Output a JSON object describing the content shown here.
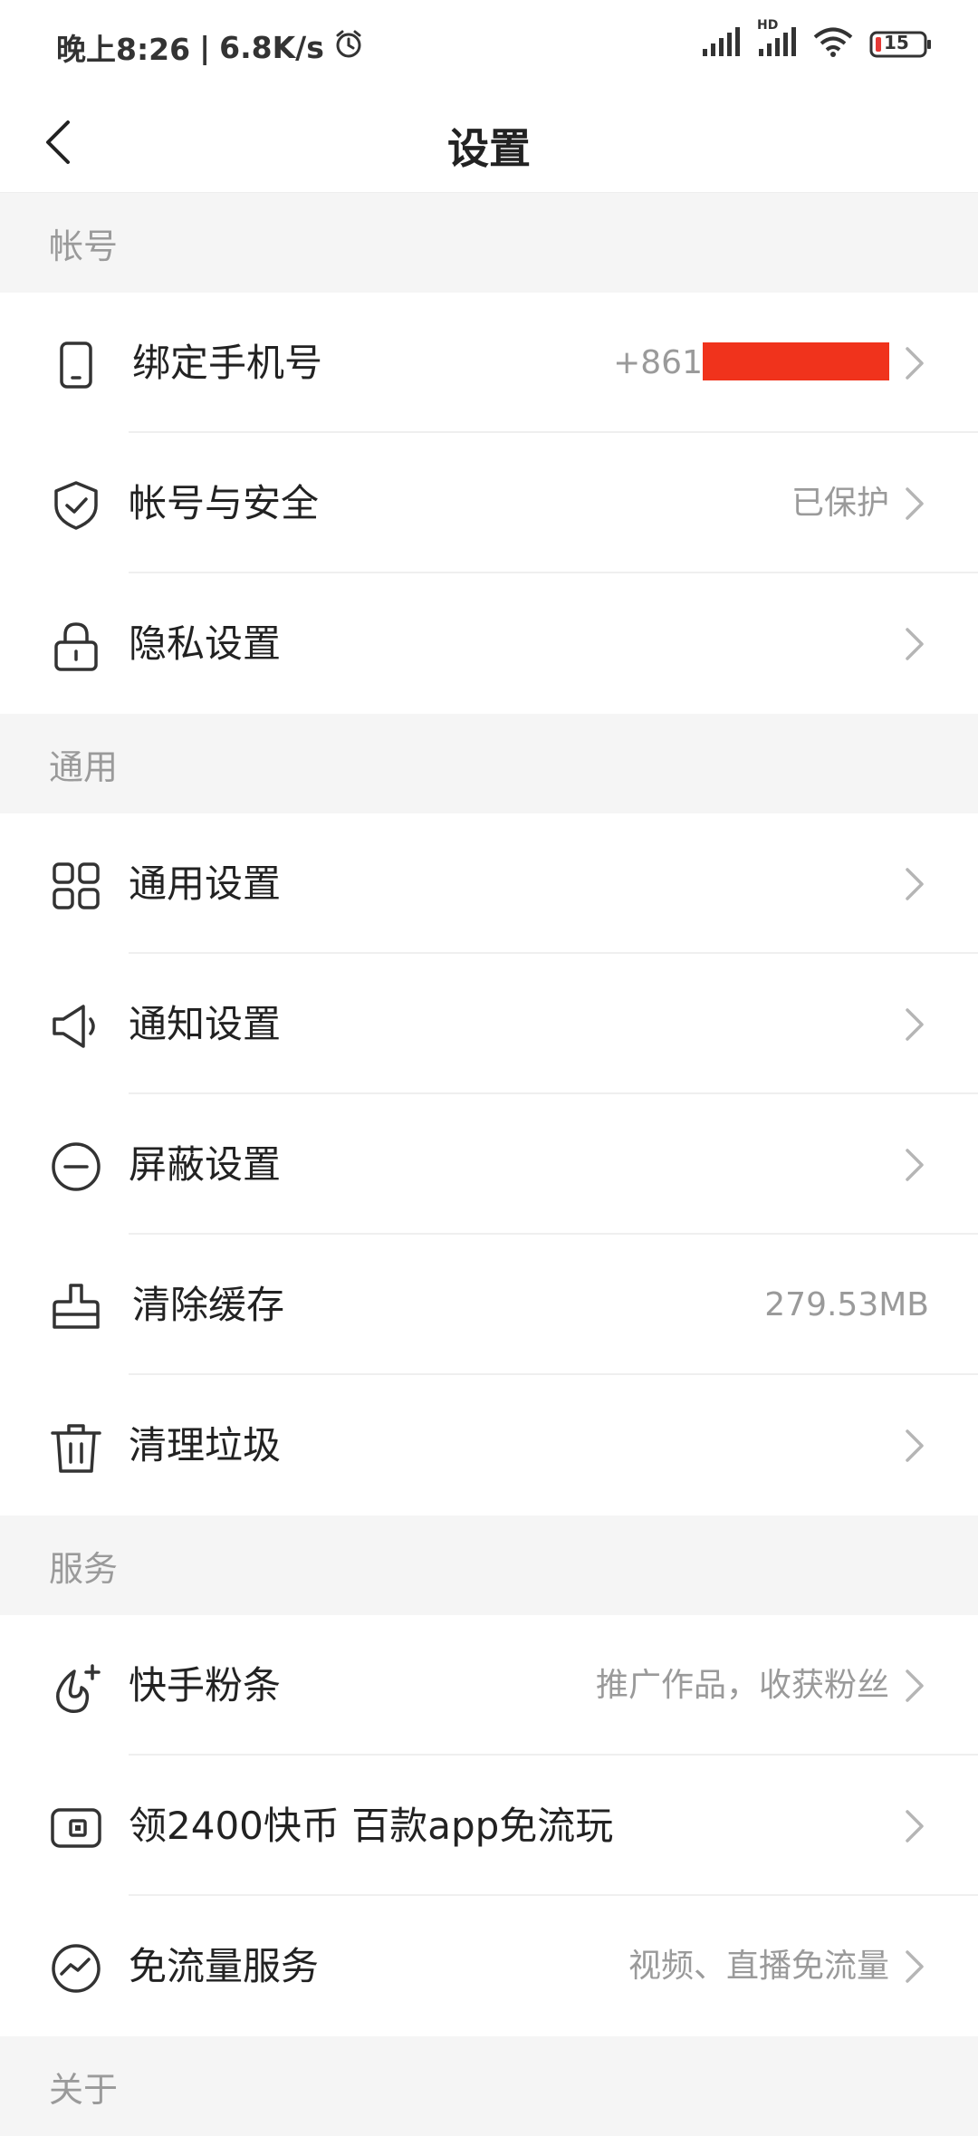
{
  "status": {
    "time": "晚上8:26",
    "net_speed": "6.8K/s",
    "battery": "15",
    "hd_label": "HD"
  },
  "header": {
    "title": "设置"
  },
  "sections": [
    {
      "title": "帐号",
      "items": [
        {
          "label": "绑定手机号",
          "value": "+861",
          "icon": "phone-icon"
        },
        {
          "label": "帐号与安全",
          "value": "已保护",
          "icon": "shield-check-icon"
        },
        {
          "label": "隐私设置",
          "value": "",
          "icon": "lock-icon"
        }
      ]
    },
    {
      "title": "通用",
      "items": [
        {
          "label": "通用设置",
          "value": "",
          "icon": "grid-icon"
        },
        {
          "label": "通知设置",
          "value": "",
          "icon": "speaker-icon"
        },
        {
          "label": "屏蔽设置",
          "value": "",
          "icon": "block-icon"
        },
        {
          "label": "清除缓存",
          "value": "279.53MB",
          "icon": "broom-icon"
        },
        {
          "label": "清理垃圾",
          "value": "",
          "icon": "trash-icon"
        }
      ]
    },
    {
      "title": "服务",
      "items": [
        {
          "label": "快手粉条",
          "value": "推广作品，收获粉丝",
          "icon": "fan-boost-icon"
        },
        {
          "label": "领2400快币 百款app免流玩",
          "value": "",
          "icon": "coin-wallet-icon"
        },
        {
          "label": "免流量服务",
          "value": "视频、直播免流量",
          "icon": "data-free-icon"
        }
      ]
    },
    {
      "title": "关于",
      "items": []
    }
  ],
  "colors": {
    "redaction": "#f0331c",
    "battery_low": "#e53935"
  }
}
